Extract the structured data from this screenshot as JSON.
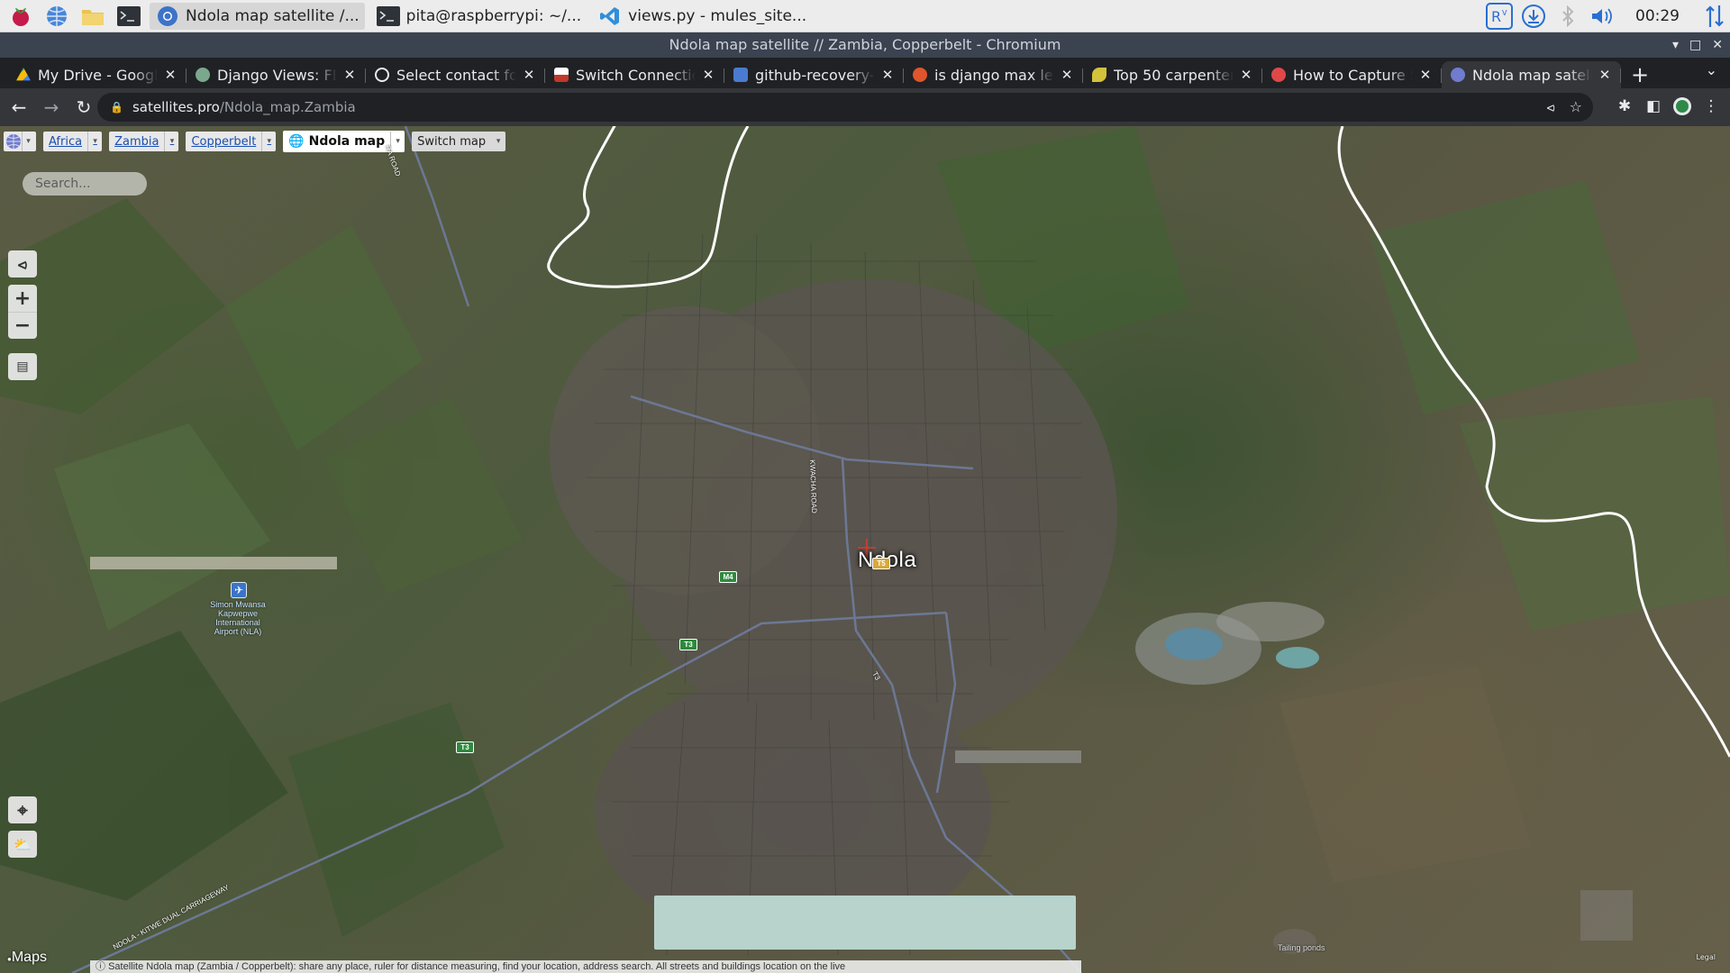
{
  "taskbar": {
    "tasks": [
      {
        "label": "Ndola map satellite /...",
        "active": true
      },
      {
        "label": "pita@raspberrypi: ~/..."
      },
      {
        "label": "views.py - mules_site..."
      }
    ],
    "clock": "00:29"
  },
  "window": {
    "title": "Ndola map satellite // Zambia, Copperbelt - Chromium"
  },
  "tabs": [
    {
      "label": "My Drive - Google Drive",
      "favicon_color": "#f4b400"
    },
    {
      "label": "Django Views: FBV vs CBV",
      "favicon_color": "#7aa88f"
    },
    {
      "label": "Select contact form",
      "favicon_color": "#e8eaed"
    },
    {
      "label": "Switch Connections",
      "favicon_color": "#c0392b"
    },
    {
      "label": "github-recovery-codes",
      "favicon_color": "#4a7bd0"
    },
    {
      "label": "is django max length",
      "favicon_color": "#e0552d"
    },
    {
      "label": "Top 50 carpenter words",
      "favicon_color": "#d4c23a"
    },
    {
      "label": "How to Capture Screenshots",
      "favicon_color": "#e04848"
    },
    {
      "label": "Ndola map satellite",
      "favicon_color": "#6f7ccf",
      "active": true
    }
  ],
  "toolbar": {
    "url_host": "satellites.pro",
    "url_path": "/Ndola_map.Zambia"
  },
  "map": {
    "breadcrumbs": [
      {
        "label": "Africa"
      },
      {
        "label": "Zambia"
      },
      {
        "label": "Copperbelt"
      }
    ],
    "current_map": "Ndola map",
    "switch_map": "Switch map",
    "search_placeholder": "Search...",
    "city_label": "Ndola",
    "airport_label": "Simon Mwansa Kapwepwe International Airport (NLA)",
    "road_labels": {
      "kwacha": "KWACHA ROAD",
      "dual_carriageway": "NDOLA - KITWE DUAL CARRIAGEWAY",
      "top_left": "RA ROAD",
      "t3_small": "T3"
    },
    "shields": {
      "m4": "M4",
      "t3_a": "T3",
      "t3_b": "T3",
      "t5": "T5"
    },
    "tailings_label": "Tailing ponds",
    "maps_logo": "Maps",
    "legal": "Legal",
    "description": "Satellite Ndola map (Zambia / Copperbelt): share any place, ruler for distance measuring, find your location, address search. All streets and buildings location on the live"
  }
}
